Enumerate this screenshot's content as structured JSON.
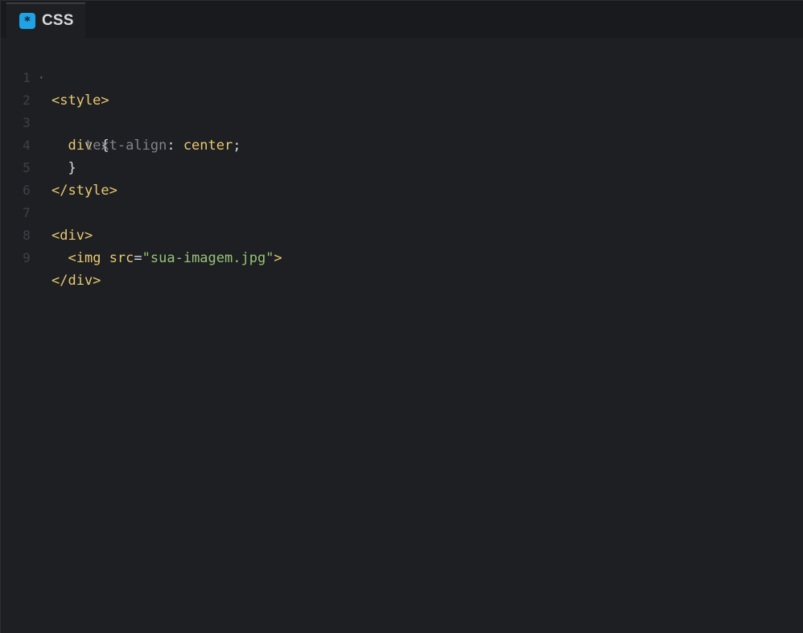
{
  "tab": {
    "icon": "*",
    "label": "CSS"
  },
  "editor": {
    "lines": [
      {
        "num": "1"
      },
      {
        "num": "2"
      },
      {
        "num": "3"
      },
      {
        "num": "4"
      },
      {
        "num": "5"
      },
      {
        "num": "6"
      },
      {
        "num": "7"
      },
      {
        "num": "8"
      },
      {
        "num": "9"
      }
    ],
    "fold_marker": "▾",
    "tokens": {
      "style_open": "<style>",
      "div_selector": "div",
      "brace_open": "{",
      "prop_text_align": "text-align",
      "colon": ":",
      "value_center": "center",
      "semicolon": ";",
      "brace_close": "}",
      "style_close": "</style>",
      "div_open": "<div>",
      "img_tag": "<img",
      "src_attr": "src",
      "equals": "=",
      "src_value": "\"sua-imagem.jpg\"",
      "tag_end": ">",
      "div_close": "</div>"
    }
  }
}
